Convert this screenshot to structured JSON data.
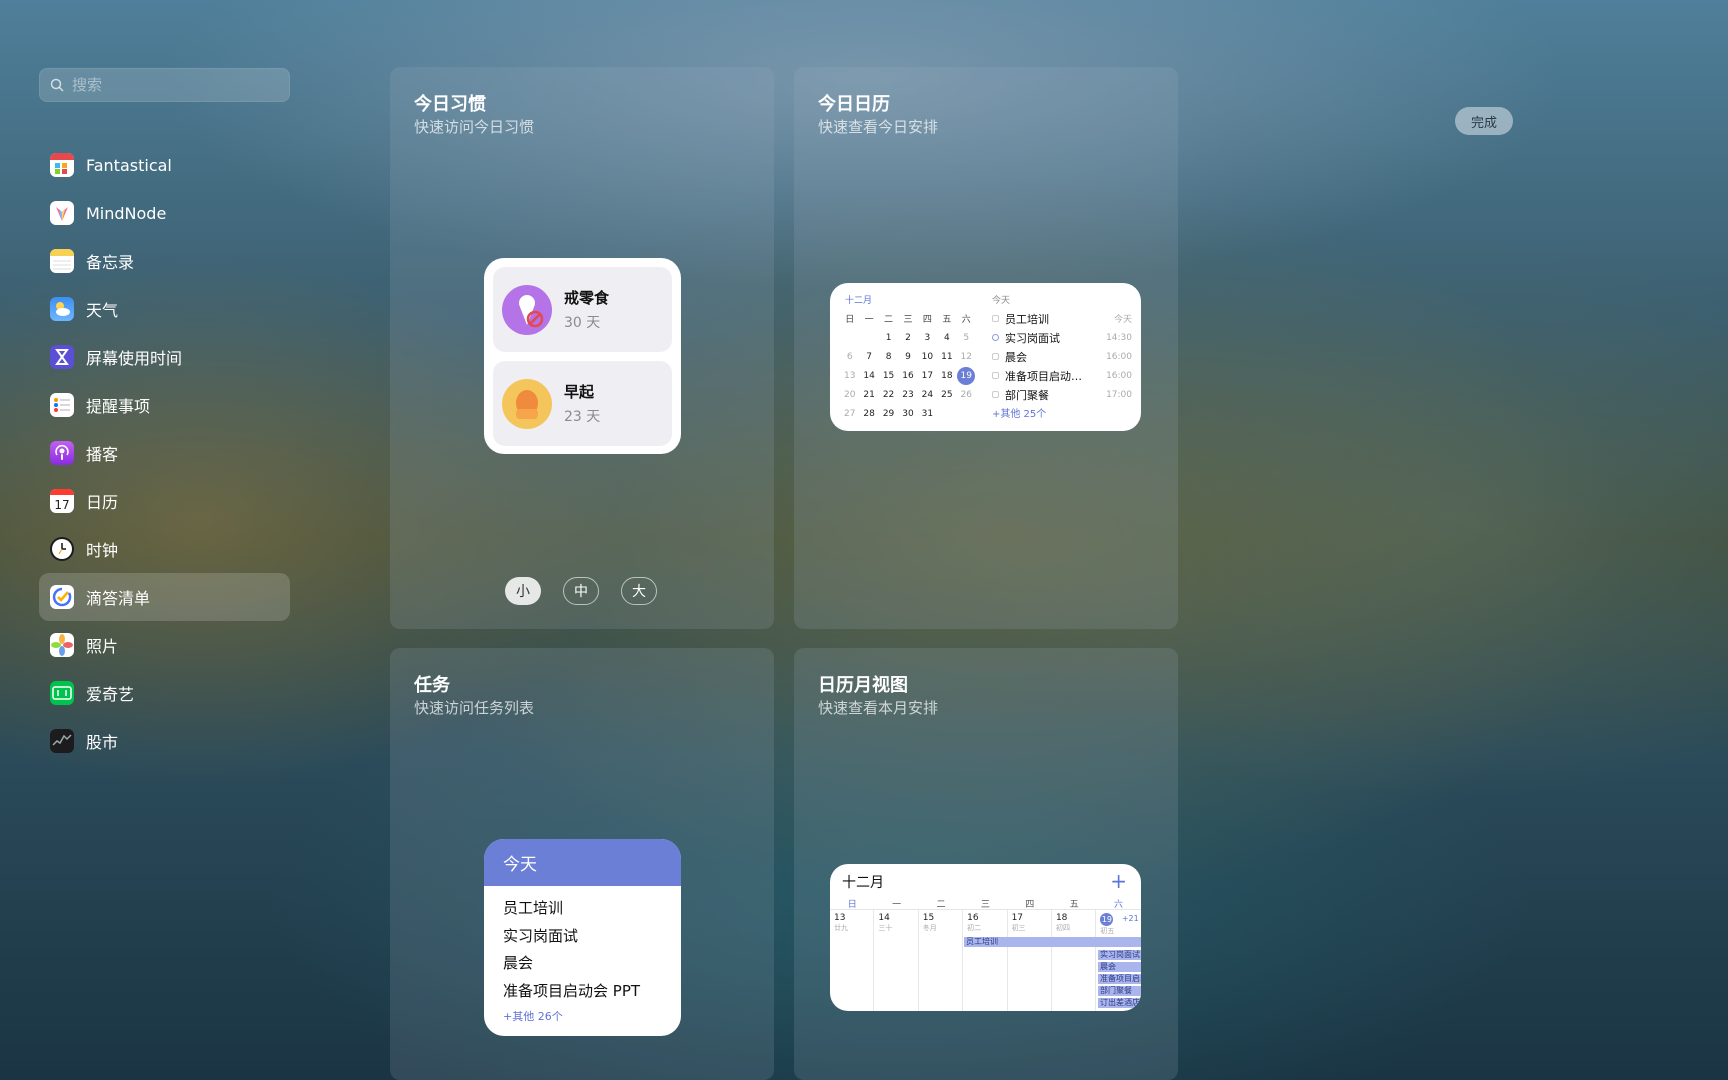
{
  "search": {
    "placeholder": "搜索"
  },
  "done_label": "完成",
  "sidebar": {
    "items": [
      {
        "label": "Fantastical",
        "icon": "fantastical-icon"
      },
      {
        "label": "MindNode",
        "icon": "mindnode-icon"
      },
      {
        "label": "备忘录",
        "icon": "notes-icon"
      },
      {
        "label": "天气",
        "icon": "weather-icon"
      },
      {
        "label": "屏幕使用时间",
        "icon": "screen-time-icon"
      },
      {
        "label": "提醒事项",
        "icon": "reminders-icon"
      },
      {
        "label": "播客",
        "icon": "podcasts-icon"
      },
      {
        "label": "日历",
        "icon": "calendar-icon"
      },
      {
        "label": "时钟",
        "icon": "clock-icon"
      },
      {
        "label": "滴答清单",
        "icon": "ticktick-icon",
        "selected": true
      },
      {
        "label": "照片",
        "icon": "photos-icon"
      },
      {
        "label": "爱奇艺",
        "icon": "iqiyi-icon"
      },
      {
        "label": "股市",
        "icon": "stocks-icon"
      }
    ]
  },
  "panels": {
    "habit": {
      "title": "今日习惯",
      "subtitle": "快速访问今日习惯",
      "habits": [
        {
          "name": "戒零食",
          "days": "30 天",
          "color": "#b473e6"
        },
        {
          "name": "早起",
          "days": "23 天",
          "color": "#f3c55b"
        }
      ],
      "sizes": [
        "小",
        "中",
        "大"
      ],
      "selected_size": "小"
    },
    "calendar": {
      "title": "今日日历",
      "subtitle": "快速查看今日安排",
      "month": "十二月",
      "weekdays": [
        "日",
        "一",
        "二",
        "三",
        "四",
        "五",
        "六"
      ],
      "weeks": [
        [
          "",
          "",
          "1",
          "2",
          "3",
          "4",
          "5"
        ],
        [
          "6",
          "7",
          "8",
          "9",
          "10",
          "11",
          "12"
        ],
        [
          "13",
          "14",
          "15",
          "16",
          "17",
          "18",
          "19"
        ],
        [
          "20",
          "21",
          "22",
          "23",
          "24",
          "25",
          "26"
        ],
        [
          "27",
          "28",
          "29",
          "30",
          "31",
          "",
          ""
        ]
      ],
      "today": "19",
      "today_label": "今天",
      "events": [
        {
          "title": "员工培训",
          "time": "今天"
        },
        {
          "title": "实习岗面试",
          "time": "14:30"
        },
        {
          "title": "晨会",
          "time": "16:00"
        },
        {
          "title": "准备项目启动…",
          "time": "16:00"
        },
        {
          "title": "部门聚餐",
          "time": "17:00"
        }
      ],
      "more": "+其他 25个"
    },
    "tasks": {
      "title": "任务",
      "subtitle": "快速访问任务列表",
      "header": "今天",
      "items": [
        "员工培训",
        "实习岗面试",
        "晨会",
        "准备项目启动会 PPT"
      ],
      "more": "+其他 26个"
    },
    "month": {
      "title": "日历月视图",
      "subtitle": "快速查看本月安排",
      "month": "十二月",
      "add": "+",
      "weekdays": [
        "日",
        "一",
        "二",
        "三",
        "四",
        "五",
        "六"
      ],
      "days": [
        {
          "num": "13",
          "lunar": "廿九"
        },
        {
          "num": "14",
          "lunar": "三十"
        },
        {
          "num": "15",
          "lunar": "冬月"
        },
        {
          "num": "16",
          "lunar": "初二"
        },
        {
          "num": "17",
          "lunar": "初三"
        },
        {
          "num": "18",
          "lunar": "初四"
        },
        {
          "num": "19",
          "lunar": "初五"
        }
      ],
      "extra": "+21",
      "span_event": "员工培训",
      "day_events": [
        "实习岗面试",
        "晨会",
        "准备项目启动",
        "部门聚餐",
        "订出差酒店"
      ]
    }
  },
  "colors": {
    "accent": "#6b7fd7"
  }
}
